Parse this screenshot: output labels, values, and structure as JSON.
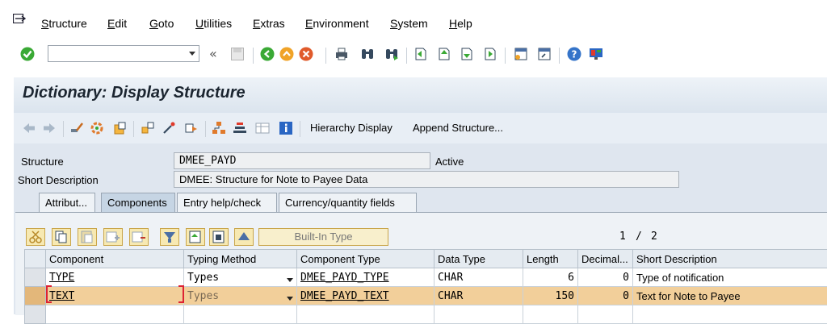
{
  "menu": {
    "items": [
      "Structure",
      "Edit",
      "Goto",
      "Utilities",
      "Extras",
      "Environment",
      "System",
      "Help"
    ]
  },
  "system_toolbar": {
    "command_field_value": "",
    "icons": [
      "enter-icon",
      "back-icon",
      "exit-icon",
      "cancel-icon",
      "print-icon",
      "find-icon",
      "find-next-icon",
      "first-page-icon",
      "previous-page-icon",
      "next-page-icon",
      "last-page-icon",
      "new-session-icon",
      "shortcut-icon",
      "help-icon",
      "layout-icon"
    ]
  },
  "title": "Dictionary: Display Structure",
  "app_toolbar": {
    "hierarchy_display": "Hierarchy Display",
    "append_structure": "Append Structure..."
  },
  "header_fields": {
    "structure_label": "Structure",
    "structure_value": "DMEE_PAYD",
    "status": "Active",
    "short_description_label": "Short Description",
    "short_description_value": "DMEE: Structure for Note to Payee Data"
  },
  "tabs": [
    {
      "label": "Attribut...",
      "active": false
    },
    {
      "label": "Components",
      "active": true
    },
    {
      "label": "Entry help/check",
      "active": false
    },
    {
      "label": "Currency/quantity fields",
      "active": false
    }
  ],
  "grid_toolbar": {
    "builtin_type": "Built-In Type",
    "page_current": "1",
    "page_sep": "/",
    "page_total": "2"
  },
  "table": {
    "columns": [
      "Component",
      "Typing Method",
      "Component Type",
      "Data Type",
      "Length",
      "Decimal...",
      "Short Description"
    ],
    "rows": [
      {
        "component": "TYPE",
        "typing_method": "Types",
        "component_type": "DMEE_PAYD_TYPE",
        "data_type": "CHAR",
        "length": "6",
        "decimals": "0",
        "description": "Type of notification",
        "highlighted": false
      },
      {
        "component": "TEXT",
        "typing_method": "Types",
        "component_type": "DMEE_PAYD_TEXT",
        "data_type": "CHAR",
        "length": "150",
        "decimals": "0",
        "description": "Text for Note to Payee",
        "highlighted": true
      }
    ]
  },
  "colors": {
    "enter_green": "#3aa935",
    "highlight_row": "#f2cf9a",
    "title_bg": "#dbe4ee",
    "help_blue": "#3574c9"
  }
}
